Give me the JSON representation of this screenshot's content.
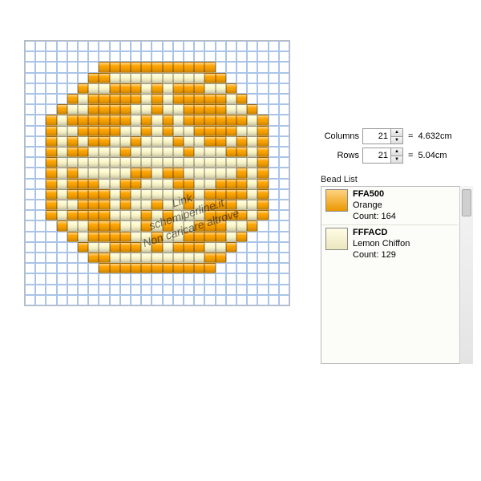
{
  "grid": {
    "cols": 21,
    "rows": 21,
    "colors": {
      "O": "#FFA500",
      "C": "#FFFACD",
      ".": ""
    },
    "pattern": [
      ".....OOOOOOOOOOO.....",
      "....OOCCCCCCCCCOO....",
      "...OCCOOOCOCOOOCCO...",
      "..OCOOOOOCOCOOOOOCO..",
      ".OCCOOOOCCOCCOOOOCCO.",
      "OCOOOOOOCOCOCOOOOOOCO",
      "OCCOOOOCCOCOCCOOOOCCO",
      "OCOCOOCCOCCCOCCOOCOCO",
      "OCOOCCCOCCCCCOCCCOOCO",
      "OCCCCCCCCCCCCCCCCCCCO",
      "OCOCCCCCOOCOOCCCCCOCO",
      "OCOOOCCOOCCCOOCCOOOCO",
      "OCOOOOCOCCCCCOCOOOOCO",
      "OCCOOOCOCCOCCOCOOOCCO",
      "OCOOOOCCCOCOCCCOOOOCO",
      ".OCCOOOCCOCOCCOOOCCO.",
      "..OCOOOOCCOCCOOOOCO..",
      "...OCCOOOCOCOOOCCO...",
      "....OOCCCCCCCCCOO....",
      ".....OOOOOOOOOOO.....",
      "....................."
    ]
  },
  "watermark": {
    "line1": "Link",
    "line2": "schemiperline.it",
    "line3": "Non caricare altrove"
  },
  "panel": {
    "columns_label": "Columns",
    "rows_label": "Rows",
    "columns_value": "21",
    "rows_value": "21",
    "columns_cm": "4.632cm",
    "rows_cm": "5.04cm",
    "eq": "=",
    "bead_list_label": "Bead List",
    "items": [
      {
        "hex": "FFA500",
        "color": "#FFA500",
        "name": "Orange",
        "count_label": "Count: 164"
      },
      {
        "hex": "FFFACD",
        "color": "#FFFACD",
        "name": "Lemon Chiffon",
        "count_label": "Count: 129"
      }
    ]
  }
}
